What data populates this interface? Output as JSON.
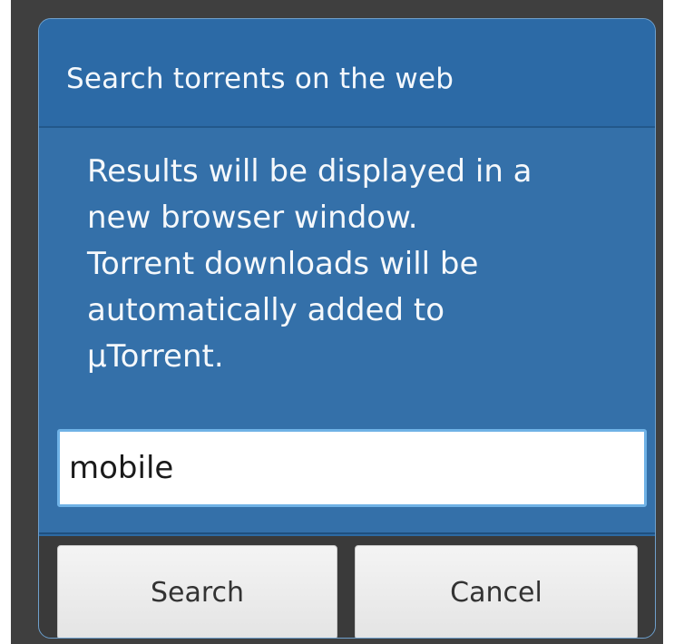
{
  "dialog": {
    "title": "Search torrents on the web",
    "message_lines": [
      "Results will be displayed in a",
      "new browser window.",
      "Torrent downloads will be",
      "automatically added to",
      "µTorrent."
    ],
    "search_value": "mobile",
    "search_label": "Search",
    "cancel_label": "Cancel"
  },
  "colors": {
    "dialog_background": "#2d6aa3",
    "input_border": "#6fb2e6",
    "button_background": "#ececec"
  }
}
